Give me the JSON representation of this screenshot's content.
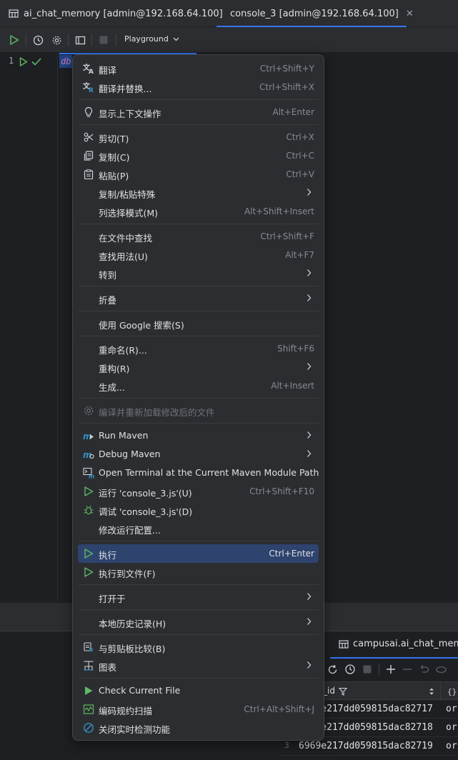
{
  "tabs": [
    {
      "label": "ai_chat_memory [admin@192.168.64.100]",
      "icon": "table-icon"
    },
    {
      "label": "console_3 [admin@192.168.64.100]",
      "icon": "mongodb-leaf-icon",
      "active": true
    }
  ],
  "toolbar": {
    "playground_label": "Playground"
  },
  "editor": {
    "line_number": "1",
    "code": "db"
  },
  "results": {
    "tab_label": "campusai.ai_chat_memory",
    "column_header": "_id",
    "rows": [
      {
        "n": "",
        "id": "6969e217dd059815dac82717",
        "extra": "or"
      },
      {
        "n": "",
        "id": "6969e217dd059815dac82718",
        "extra": "or"
      },
      {
        "n": "3",
        "id": "6969e217dd059815dac82719",
        "extra": "or"
      }
    ]
  },
  "menu": {
    "items": [
      {
        "label": "翻译",
        "shortcut": "Ctrl+Shift+Y",
        "icon": "translate-icon"
      },
      {
        "label": "翻译并替换...",
        "shortcut": "Ctrl+Shift+X",
        "icon": "translate-replace-icon"
      },
      {
        "label": "显示上下文操作",
        "shortcut": "Alt+Enter",
        "icon": "lightbulb-icon"
      },
      {
        "label": "剪切(T)",
        "shortcut": "Ctrl+X",
        "icon": "scissors-icon"
      },
      {
        "label": "复制(C)",
        "shortcut": "Ctrl+C",
        "icon": "copy-icon"
      },
      {
        "label": "粘贴(P)",
        "shortcut": "Ctrl+V",
        "icon": "paste-icon"
      },
      {
        "label": "复制/粘贴特殊",
        "shortcut": "",
        "icon": ""
      },
      {
        "label": "列选择模式(M)",
        "shortcut": "Alt+Shift+Insert",
        "icon": ""
      },
      {
        "label": "在文件中查找",
        "shortcut": "Ctrl+Shift+F",
        "icon": ""
      },
      {
        "label": "查找用法(U)",
        "shortcut": "Alt+F7",
        "icon": ""
      },
      {
        "label": "转到",
        "shortcut": "",
        "icon": ""
      },
      {
        "label": "折叠",
        "shortcut": "",
        "icon": ""
      },
      {
        "label": "使用 Google 搜索(S)",
        "shortcut": "",
        "icon": ""
      },
      {
        "label": "重命名(R)...",
        "shortcut": "Shift+F6",
        "icon": ""
      },
      {
        "label": "重构(R)",
        "shortcut": "",
        "icon": ""
      },
      {
        "label": "生成...",
        "shortcut": "Alt+Insert",
        "icon": ""
      },
      {
        "label": "编译并重新加载修改后的文件",
        "shortcut": "",
        "icon": "compile-gear-icon"
      },
      {
        "label": "Run Maven",
        "shortcut": "",
        "icon": "maven-run-icon"
      },
      {
        "label": "Debug Maven",
        "shortcut": "",
        "icon": "maven-debug-icon"
      },
      {
        "label": "Open Terminal at the Current Maven Module Path",
        "shortcut": "",
        "icon": "terminal-maven-icon"
      },
      {
        "label": "运行 'console_3.js'(U)",
        "shortcut": "Ctrl+Shift+F10",
        "icon": "run-icon"
      },
      {
        "label": "调试 'console_3.js'(D)",
        "shortcut": "",
        "icon": "debug-bug-icon"
      },
      {
        "label": "修改运行配置...",
        "shortcut": "",
        "icon": ""
      },
      {
        "label": "执行",
        "shortcut": "Ctrl+Enter",
        "icon": "execute-icon"
      },
      {
        "label": "执行到文件(F)",
        "shortcut": "",
        "icon": "execute-to-file-icon"
      },
      {
        "label": "打开于",
        "shortcut": "",
        "icon": ""
      },
      {
        "label": "本地历史记录(H)",
        "shortcut": "",
        "icon": ""
      },
      {
        "label": "与剪贴板比较(B)",
        "shortcut": "",
        "icon": "compare-clipboard-icon"
      },
      {
        "label": "图表",
        "shortcut": "",
        "icon": "diagram-icon"
      },
      {
        "label": "Check Current File",
        "shortcut": "",
        "icon": "check-file-icon"
      },
      {
        "label": "编码规约扫描",
        "shortcut": "Ctrl+Alt+Shift+J",
        "icon": "code-scan-icon"
      },
      {
        "label": "关闭实时检测功能",
        "shortcut": "",
        "icon": "disable-realtime-icon"
      }
    ]
  },
  "colors": {
    "accent": "#3574f0",
    "menu_active": "#2e436e",
    "run_green": "#5fb865",
    "maven_blue": "#3592c4"
  }
}
